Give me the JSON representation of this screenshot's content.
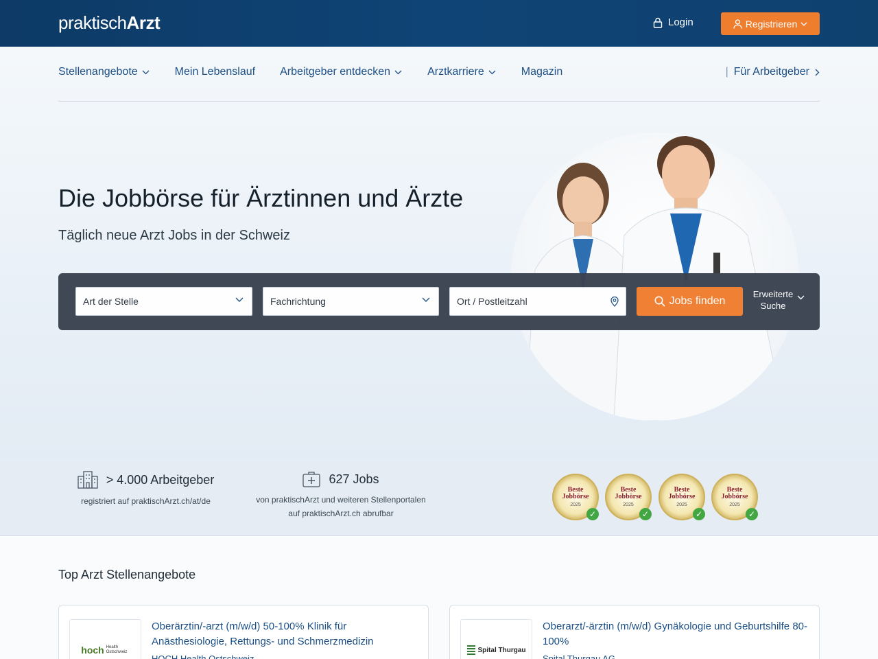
{
  "header": {
    "logo_part1": "praktisch",
    "logo_part2": "Arzt",
    "login_label": "Login",
    "register_label": "Registrieren"
  },
  "nav": {
    "items": [
      {
        "label": "Stellenangebote",
        "dropdown": true
      },
      {
        "label": "Mein Lebenslauf",
        "dropdown": false
      },
      {
        "label": "Arbeitgeber entdecken",
        "dropdown": true
      },
      {
        "label": "Arztkarriere",
        "dropdown": true
      },
      {
        "label": "Magazin",
        "dropdown": false
      }
    ],
    "right_label": "Für Arbeitgeber"
  },
  "hero": {
    "headline": "Die Jobbörse für Ärztinnen und Ärzte",
    "subline": "Täglich neue Arzt Jobs in der Schweiz"
  },
  "search": {
    "field1": "Art der Stelle",
    "field2": "Fachrichtung",
    "field3_placeholder": "Ort / Postleitzahl",
    "find_label": "Jobs finden",
    "advanced_line1": "Erweiterte",
    "advanced_line2": "Suche"
  },
  "stats": {
    "employers_main": "> 4.000 Arbeitgeber",
    "employers_sub": "registriert auf praktischArzt.ch/at/de",
    "jobs_main": "627 Jobs",
    "jobs_sub_line1": "von praktischArzt und weiteren Stellenportalen",
    "jobs_sub_line2": "auf praktischArzt.ch abrufbar"
  },
  "badges": [
    {
      "line1": "Beste",
      "line2": "Jobbörse",
      "year": "2025"
    },
    {
      "line1": "Beste",
      "line2": "Jobbörse",
      "year": "2025"
    },
    {
      "line1": "Beste",
      "line2": "Jobbörse",
      "year": "2025"
    },
    {
      "line1": "Beste",
      "line2": "Jobbörse",
      "year": "2025"
    }
  ],
  "listings": {
    "title": "Top Arzt Stellenangebote",
    "cards": [
      {
        "logo_text": "hoch",
        "logo_sub": "Health Ostschweiz",
        "title": "Oberärztin/-arzt (m/w/d) 50-100% Klinik für Anästhesiologie, Rettungs- und Schmerzmedizin",
        "company": "HOCH Health Ostschweiz"
      },
      {
        "logo_text": "Spital Thurgau",
        "logo_sub": "",
        "title": "Oberarzt/-ärztin (m/w/d) Gynäkologie und Geburtshilfe 80-100%",
        "company": "Spital Thurgau AG"
      }
    ]
  },
  "colors": {
    "header_bg": "#0f4476",
    "accent_orange": "#ef7d2e",
    "link_blue": "#1b4f85",
    "searchbar_bg": "#3b4250"
  }
}
